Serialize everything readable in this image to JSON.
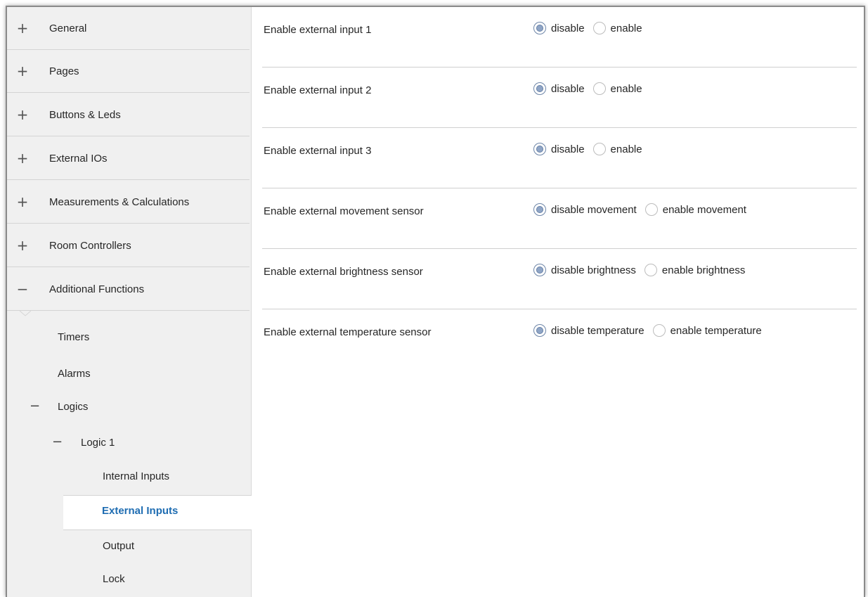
{
  "sidebar": {
    "sections": [
      {
        "sign": "+",
        "label": "General"
      },
      {
        "sign": "+",
        "label": "Pages"
      },
      {
        "sign": "+",
        "label": "Buttons & Leds"
      },
      {
        "sign": "+",
        "label": "External IOs"
      },
      {
        "sign": "+",
        "label": "Measurements & Calculations"
      },
      {
        "sign": "+",
        "label": "Room Controllers"
      },
      {
        "sign": "−",
        "label": "Additional Functions"
      }
    ],
    "sub_items": {
      "timers": "Timers",
      "alarms": "Alarms",
      "logics_sign": "−",
      "logics": "Logics",
      "logic1_sign": "−",
      "logic1": "Logic 1",
      "internal_inputs": "Internal Inputs",
      "external_inputs": "External Inputs",
      "output": "Output",
      "lock": "Lock"
    },
    "selected_color": "#1f6db2"
  },
  "settings": {
    "rows": [
      {
        "label": "Enable external input 1",
        "options": [
          "disable",
          "enable"
        ],
        "selected": 0
      },
      {
        "label": "Enable external input 2",
        "options": [
          "disable",
          "enable"
        ],
        "selected": 0
      },
      {
        "label": "Enable external input 3",
        "options": [
          "disable",
          "enable"
        ],
        "selected": 0
      },
      {
        "label": "Enable external movement sensor",
        "options": [
          "disable movement",
          "enable movement"
        ],
        "selected": 0
      },
      {
        "label": "Enable external brightness sensor",
        "options": [
          "disable brightness",
          "enable brightness"
        ],
        "selected": 0
      },
      {
        "label": "Enable external temperature sensor",
        "options": [
          "disable temperature",
          "enable temperature"
        ],
        "selected": 0
      }
    ]
  }
}
